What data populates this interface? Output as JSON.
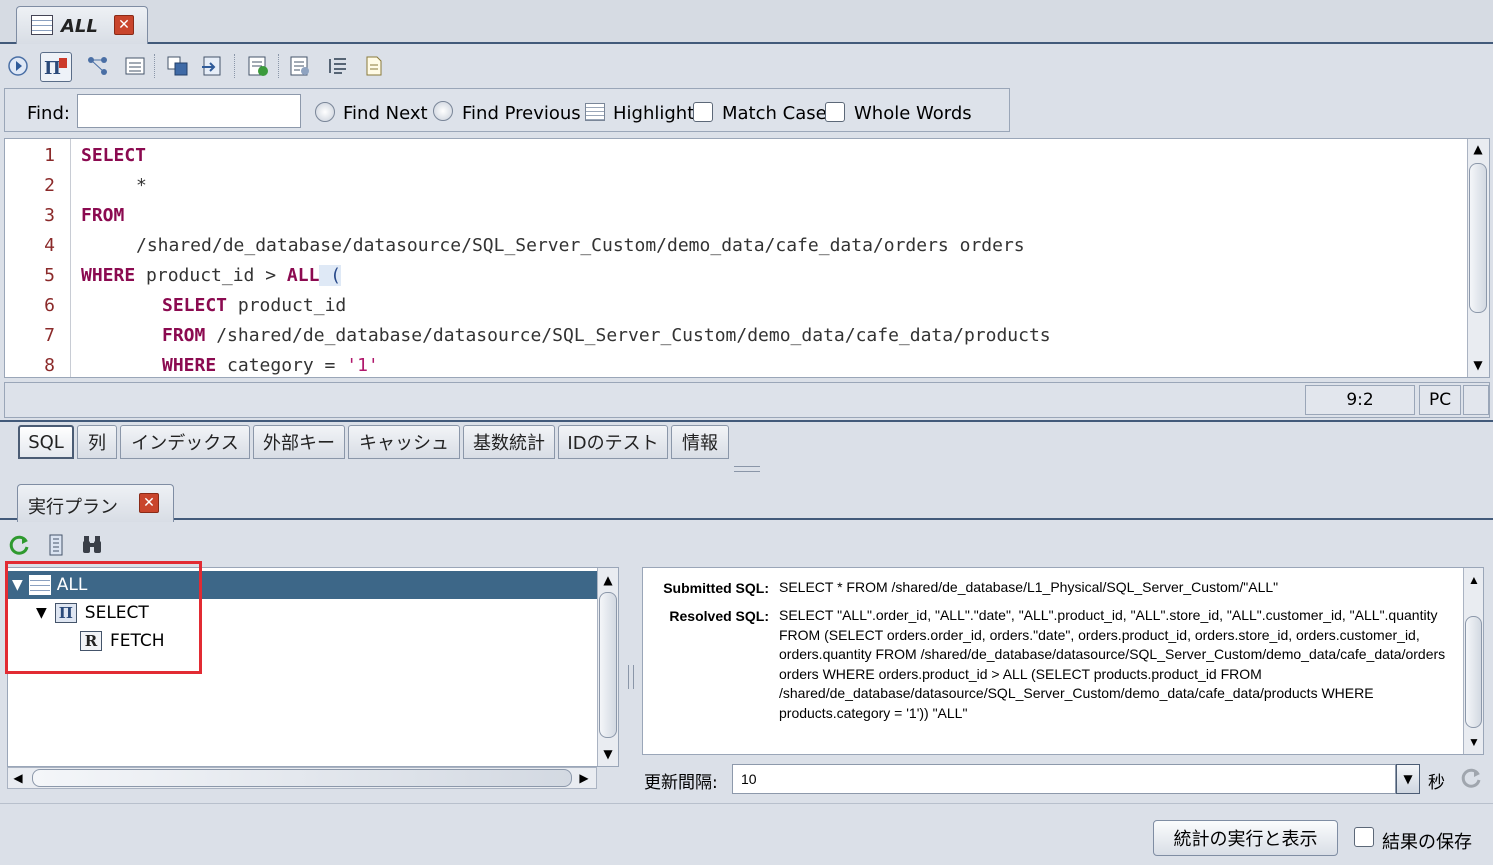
{
  "doc_tab": {
    "title": "ALL",
    "close_glyph": "✕"
  },
  "toolbar": {
    "icons": [
      "run-icon",
      "query-plan-icon",
      "tree-icon",
      "print-icon",
      "save-icon",
      "export-icon",
      "insert-icon",
      "properties-icon",
      "format-icon",
      "document-icon"
    ]
  },
  "find_bar": {
    "label": "Find:",
    "value": "",
    "find_next": "Find Next",
    "find_previous": "Find Previous",
    "highlight": "Highlight",
    "match_case": "Match Case",
    "whole_words": "Whole Words"
  },
  "editor": {
    "line_numbers": [
      "1",
      "2",
      "3",
      "4",
      "5",
      "6",
      "7",
      "8"
    ],
    "l1_kw": "SELECT",
    "l2_text": "*",
    "l3_kw": "FROM",
    "l4_text": "/shared/de_database/datasource/SQL_Server_Custom/demo_data/cafe_data/orders orders",
    "l5_kw1": "WHERE",
    "l5_text": " product_id > ",
    "l5_kw2": "ALL",
    "l5_paren": " (",
    "l6_kw": "SELECT",
    "l6_text": " product_id",
    "l7_kw": "FROM",
    "l7_text": " /shared/de_database/datasource/SQL_Server_Custom/demo_data/cafe_data/products",
    "l8_kw": "WHERE",
    "l8_text": " category = ",
    "l8_str": "'1'"
  },
  "status": {
    "position": "9:2",
    "mode": "PC"
  },
  "bottom_tabs": [
    "SQL",
    "列",
    "インデックス",
    "外部キー",
    "キャッシュ",
    "基数統計",
    "IDのテスト",
    "情報"
  ],
  "plan": {
    "tab_title": "実行プラン",
    "close_glyph": "✕",
    "tree": [
      {
        "label": "ALL",
        "icon": "table-icon"
      },
      {
        "label": "SELECT",
        "icon": "projection-icon"
      },
      {
        "label": "FETCH",
        "icon": "relation-icon"
      }
    ],
    "submitted_label": "Submitted SQL:",
    "submitted_sql": "SELECT * FROM /shared/de_database/L1_Physical/SQL_Server_Custom/\"ALL\"",
    "resolved_label": "Resolved SQL:",
    "resolved_sql": "SELECT \"ALL\".order_id, \"ALL\".\"date\", \"ALL\".product_id, \"ALL\".store_id, \"ALL\".customer_id, \"ALL\".quantity FROM (SELECT orders.order_id, orders.\"date\", orders.product_id, orders.store_id, orders.customer_id, orders.quantity FROM /shared/de_database/datasource/SQL_Server_Custom/demo_data/cafe_data/orders orders WHERE orders.product_id > ALL (SELECT products.product_id FROM /shared/de_database/datasource/SQL_Server_Custom/demo_data/cafe_data/products WHERE products.category = '1')) \"ALL\"",
    "refresh_label": "更新間隔:",
    "refresh_value": "10",
    "seconds_label": "秒",
    "run_button": "統計の実行と表示",
    "save_results": "結果の保存"
  },
  "colors": {
    "selection": "#3d6788",
    "keyword": "#8b0a50",
    "highlight_box": "#e22b33"
  }
}
